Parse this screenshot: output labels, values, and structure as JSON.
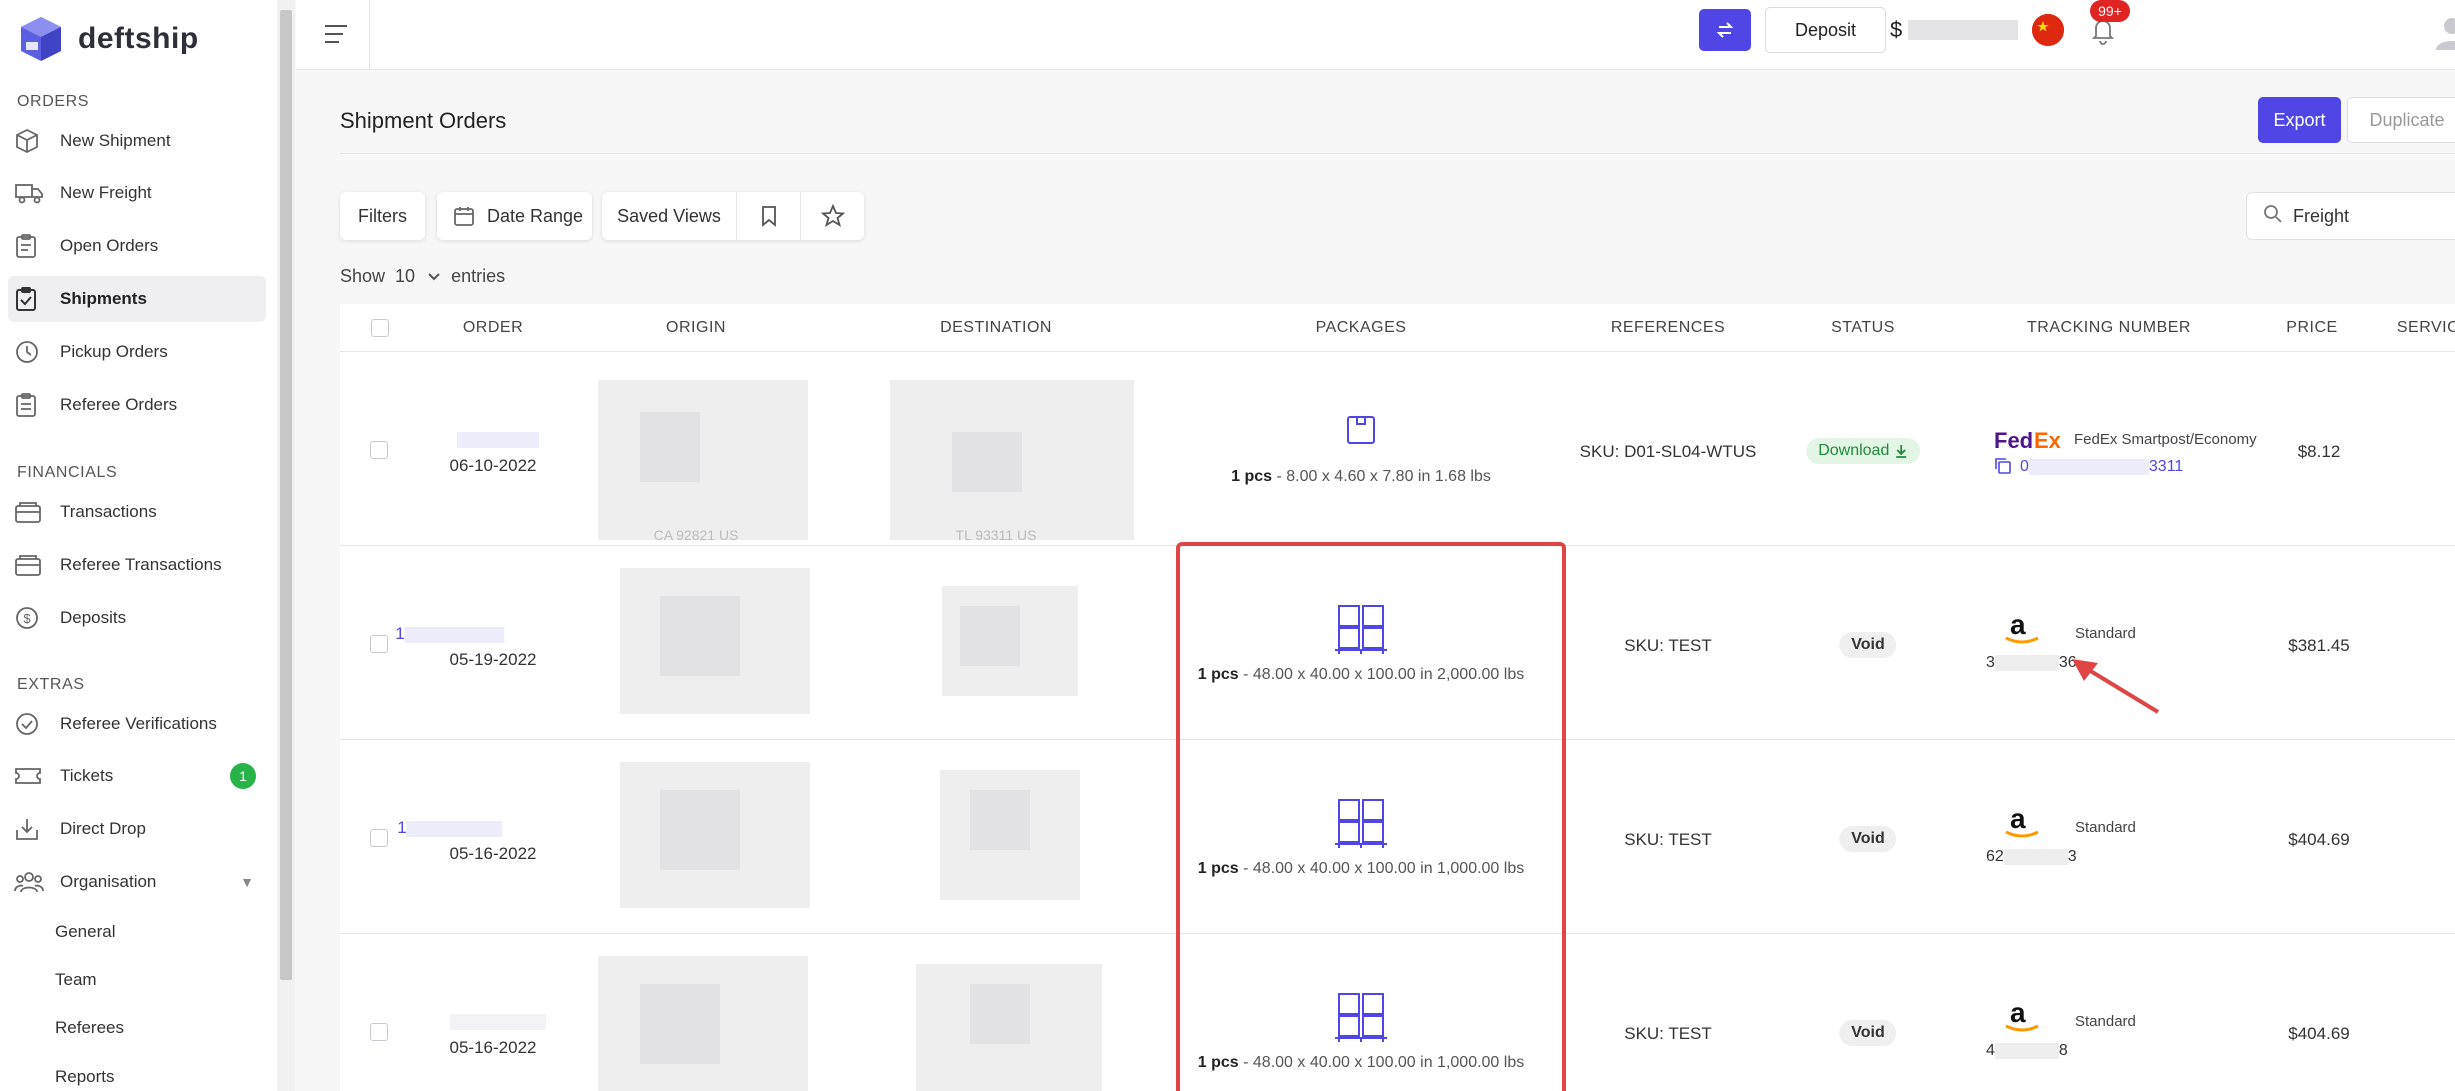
{
  "brand": {
    "name": "deftship"
  },
  "sidebar": {
    "sections": {
      "orders": "ORDERS",
      "financials": "FINANCIALS",
      "extras": "EXTRAS"
    },
    "items": {
      "new_shipment": "New Shipment",
      "new_freight": "New Freight",
      "open_orders": "Open Orders",
      "shipments": "Shipments",
      "pickup_orders": "Pickup Orders",
      "referee_orders": "Referee Orders",
      "transactions": "Transactions",
      "referee_transactions": "Referee Transactions",
      "deposits": "Deposits",
      "referee_verifications": "Referee Verifications",
      "tickets": "Tickets",
      "tickets_badge": "1",
      "direct_drop": "Direct Drop",
      "organisation": "Organisation"
    },
    "organisation_sub": {
      "general": "General",
      "team": "Team",
      "referees": "Referees",
      "reports": "Reports"
    }
  },
  "topbar": {
    "deposit_label": "Deposit",
    "currency": "$",
    "notifications_badge": "99+"
  },
  "page": {
    "title": "Shipment Orders",
    "export_label": "Export",
    "duplicate_label": "Duplicate"
  },
  "toolbar": {
    "filters": "Filters",
    "date_range": "Date Range",
    "saved_views": "Saved Views",
    "search_value": "Freight"
  },
  "entries": {
    "show": "Show",
    "value": "10",
    "suffix": "entries"
  },
  "table": {
    "columns": {
      "order": "ORDER",
      "origin": "ORIGIN",
      "destination": "DESTINATION",
      "packages": "PACKAGES",
      "references": "REFERENCES",
      "status": "STATUS",
      "tracking": "TRACKING NUMBER",
      "price": "PRICE",
      "service": "SERVIC"
    },
    "rows": [
      {
        "date": "06-10-2022",
        "origin_partial": "CA 92821 US",
        "destination_partial": "TL 93311 US",
        "pkg_qty": "1 pcs",
        "pkg_dims": " - 8.00 x 4.60 x 7.80 in  1.68 lbs",
        "reference": "SKU: D01-SL04-WTUS",
        "status": "Download",
        "carrier_label": "FedEx Smartpost/Economy",
        "tracking_suffix": "3311",
        "tracking_prefix": "0",
        "price": "$8.12"
      },
      {
        "order_prefix": "1",
        "date": "05-19-2022",
        "pkg_qty": "1 pcs",
        "pkg_dims": " - 48.00 x 40.00 x 100.00 in  2,000.00 lbs",
        "reference": "SKU: TEST",
        "status": "Void",
        "carrier_label": "Standard",
        "tracking_prefix": "3",
        "tracking_suffix": "36",
        "price": "$381.45"
      },
      {
        "order_prefix": "1",
        "date": "05-16-2022",
        "pkg_qty": "1 pcs",
        "pkg_dims": " - 48.00 x 40.00 x 100.00 in  1,000.00 lbs",
        "reference": "SKU: TEST",
        "status": "Void",
        "carrier_label": "Standard",
        "tracking_prefix": "62",
        "tracking_suffix": "3",
        "price": "$404.69"
      },
      {
        "date": "05-16-2022",
        "pkg_qty": "1 pcs",
        "pkg_dims": " - 48.00 x 40.00 x 100.00 in  1,000.00 lbs",
        "reference": "SKU: TEST",
        "status": "Void",
        "carrier_label": "Standard",
        "tracking_prefix": "4",
        "tracking_suffix": "8",
        "price": "$404.69"
      }
    ]
  },
  "colors": {
    "accent": "#4f46e5",
    "success": "#27b34a",
    "danger": "#e02424",
    "highlight": "#e04545"
  }
}
